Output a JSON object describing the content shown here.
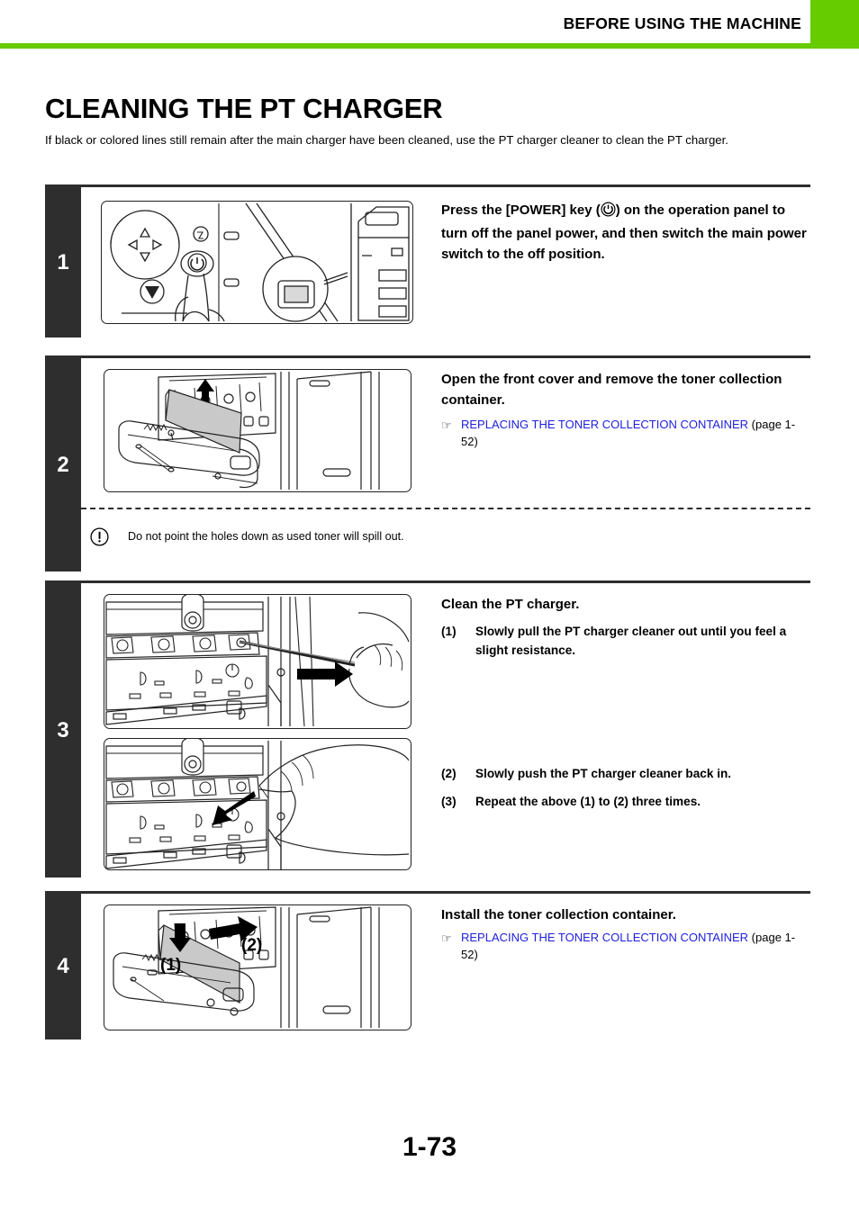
{
  "header": {
    "title": "BEFORE USING THE MACHINE",
    "accent_color": "#66cc00"
  },
  "document": {
    "title": "CLEANING THE PT CHARGER",
    "intro": "If black or colored lines still remain after the main charger have been cleaned, use the PT charger cleaner to clean the PT charger.",
    "page_number": "1-73",
    "rule_color": "#2e2e2e",
    "link_color": "#2020dd"
  },
  "steps": [
    {
      "number": "1",
      "heading_before": "Press the [POWER] key (",
      "heading_icon": "power-icon",
      "heading_after": ") on the operation panel to turn off the panel power, and then switch the main power switch to the off position.",
      "figure_name": "operation-panel-power-key-illustration"
    },
    {
      "number": "2",
      "heading": "Open the front cover and remove the toner collection container.",
      "reference": {
        "hand_icon": "☞",
        "link": "REPLACING THE TONER COLLECTION CONTAINER",
        "page": "(page 1-52)"
      },
      "figure_name": "remove-toner-collection-container-illustration",
      "caution": {
        "icon": "caution-exclamation-icon",
        "text": "Do not point the holes down as used toner will spill out."
      }
    },
    {
      "number": "3",
      "heading": "Clean the PT charger.",
      "substeps": [
        {
          "num": "(1)",
          "text": "Slowly pull the PT charger cleaner out until you feel a slight resistance."
        },
        {
          "num": "(2)",
          "text": "Slowly push the PT charger cleaner back in."
        },
        {
          "num": "(3)",
          "text": "Repeat the above (1) to (2) three times."
        }
      ],
      "figure_name_a": "pull-pt-charger-cleaner-illustration",
      "figure_name_b": "push-pt-charger-cleaner-illustration"
    },
    {
      "number": "4",
      "heading": "Install the toner collection container.",
      "reference": {
        "hand_icon": "☞",
        "link": "REPLACING THE TONER COLLECTION CONTAINER",
        "page": "(page 1-52)"
      },
      "figure_name": "install-toner-collection-container-illustration",
      "figure_labels": [
        "(1)",
        "(2)"
      ]
    }
  ]
}
